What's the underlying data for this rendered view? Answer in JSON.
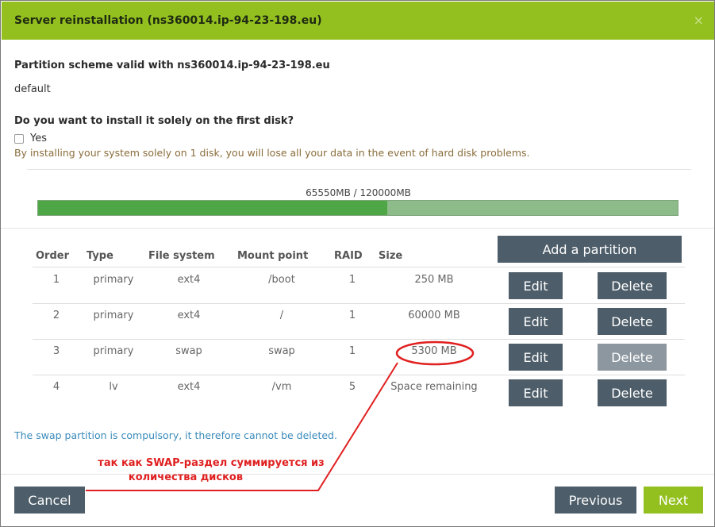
{
  "dialog": {
    "title": "Server reinstallation (ns360014.ip-94-23-198.eu)",
    "close_symbol": "×"
  },
  "scheme": {
    "heading": "Partition scheme valid with ns360014.ip-94-23-198.eu",
    "name": "default"
  },
  "first_disk": {
    "question": "Do you want to install it solely on the first disk?",
    "checkbox_label": "Yes",
    "checked": false,
    "warning": "By installing your system solely on 1 disk, you will lose all your data in the event of hard disk problems."
  },
  "usage": {
    "label": "65550MB / 120000MB",
    "used_mb": 65550,
    "total_mb": 120000,
    "used_color": "#4ea646",
    "free_color": "#8dbb8a"
  },
  "table": {
    "add_button": "Add a partition",
    "headers": [
      "Order",
      "Type",
      "File system",
      "Mount point",
      "RAID",
      "Size"
    ],
    "edit_label": "Edit",
    "delete_label": "Delete",
    "rows": [
      {
        "order": "1",
        "type": "primary",
        "fs": "ext4",
        "mount": "/boot",
        "raid": "1",
        "size": "250 MB",
        "delete_enabled": true
      },
      {
        "order": "2",
        "type": "primary",
        "fs": "ext4",
        "mount": "/",
        "raid": "1",
        "size": "60000 MB",
        "delete_enabled": true
      },
      {
        "order": "3",
        "type": "primary",
        "fs": "swap",
        "mount": "swap",
        "raid": "1",
        "size": "5300 MB",
        "delete_enabled": false
      },
      {
        "order": "4",
        "type": "lv",
        "fs": "ext4",
        "mount": "/vm",
        "raid": "5",
        "size": "Space remaining",
        "delete_enabled": true
      }
    ]
  },
  "info": "The swap partition is compulsory, it therefore cannot be deleted.",
  "annotation": {
    "line1": "так как SWAP-раздел суммируется из",
    "line2": "количества дисков",
    "color": "#e02020"
  },
  "footer": {
    "cancel": "Cancel",
    "previous": "Previous",
    "next": "Next"
  },
  "colors": {
    "header_bg": "#93c01f",
    "button_bg": "#4d5d69",
    "button_disabled_bg": "#8c979f",
    "next_bg": "#93c01f",
    "info_text": "#3a8bbb",
    "warning_text": "#8a6d3b"
  }
}
